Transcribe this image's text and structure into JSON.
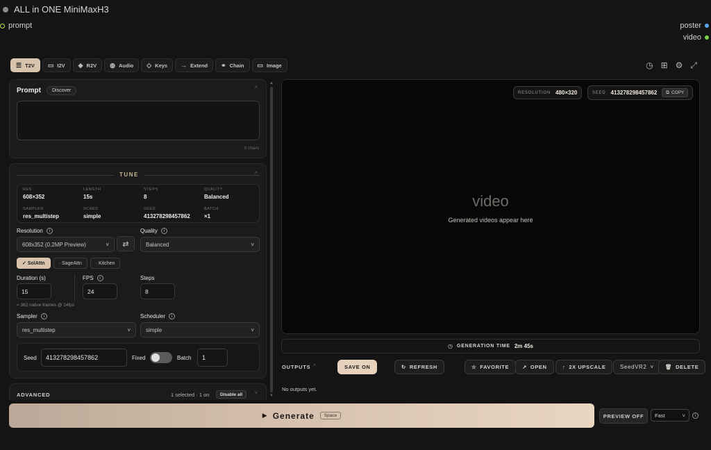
{
  "app": {
    "title": "ALL in ONE MiniMaxH3"
  },
  "ports": {
    "inputs": [
      {
        "label": "prompt",
        "color": "#b8e04a"
      }
    ],
    "outputs": [
      {
        "label": "poster",
        "color": "#5aa8e8"
      },
      {
        "label": "video",
        "color": "#7cd24a"
      }
    ]
  },
  "tabs": [
    {
      "label": "T2V",
      "icon": "lines-icon",
      "glyph": "☰",
      "active": true
    },
    {
      "label": "I2V",
      "icon": "image-icon",
      "glyph": "▭"
    },
    {
      "label": "R2V",
      "icon": "layers-icon",
      "glyph": "◈"
    },
    {
      "label": "Audio",
      "icon": "audio-icon",
      "glyph": "◍"
    },
    {
      "label": "Keys",
      "icon": "diamond-icon",
      "glyph": "◇"
    },
    {
      "label": "Extend",
      "icon": "arrow-right-icon",
      "glyph": "→"
    },
    {
      "label": "Chain",
      "icon": "link-icon",
      "glyph": "⚭"
    },
    {
      "label": "Image",
      "icon": "image-icon",
      "glyph": "▭"
    }
  ],
  "prompt": {
    "title": "Prompt",
    "discover_label": "Discover",
    "value": "",
    "chars": "0 chars"
  },
  "tune": {
    "label": "TUNE",
    "stats": [
      {
        "k": "RES",
        "v": "608×352"
      },
      {
        "k": "LENGTH",
        "v": "15s"
      },
      {
        "k": "STEPS",
        "v": "8"
      },
      {
        "k": "QUALITY",
        "v": "Balanced"
      },
      {
        "k": "SAMPLER",
        "v": "res_multistep"
      },
      {
        "k": "SCHED",
        "v": "simple"
      },
      {
        "k": "SEED",
        "v": "413278298457862"
      },
      {
        "k": "BATCH",
        "v": "×1"
      }
    ],
    "resolution_label": "Resolution",
    "resolution_value": "608x352 (0.2MP Preview)",
    "quality_label": "Quality",
    "quality_value": "Balanced",
    "attn_chips": [
      "✓ SolAttn",
      "· SageAttn",
      "· Kitchen"
    ],
    "duration_label": "Duration (s)",
    "duration_value": "15",
    "fps_label": "FPS",
    "fps_value": "24",
    "steps_label": "Steps",
    "steps_value": "8",
    "frames_hint": "≈ 362 native frames @ 24fps",
    "sampler_label": "Sampler",
    "sampler_value": "res_multistep",
    "scheduler_label": "Scheduler",
    "scheduler_value": "simple",
    "seed_label": "Seed",
    "seed_value": "413278298457862",
    "fixed_label": "Fixed",
    "fixed_on": false,
    "batch_label": "Batch",
    "batch_value": "1"
  },
  "advanced": {
    "label": "ADVANCED",
    "summary": "1 selected · 1 on",
    "disable_all": "Disable all"
  },
  "video": {
    "resolution_key": "RESOLUTION",
    "resolution_value": "480×320",
    "seed_key": "SEED",
    "seed_value": "413278298457862",
    "copy_label": "COPY",
    "placeholder_title": "video",
    "placeholder_sub": "Generated videos appear here"
  },
  "generation_time": {
    "label": "GENERATION TIME",
    "value": "2m 45s"
  },
  "outputs": {
    "label": "OUTPUTS",
    "save_on": "SAVE ON",
    "refresh": "REFRESH",
    "favorite": "FAVORITE",
    "open": "OPEN",
    "upscale": "2X UPSCALE",
    "upscaler_value": "SeedVR2",
    "delete": "DELETE",
    "empty": "No outputs yet."
  },
  "generate": {
    "label": "Generate",
    "shortcut": "Space"
  },
  "preview": {
    "label": "PREVIEW OFF",
    "mode_value": "Fast"
  }
}
